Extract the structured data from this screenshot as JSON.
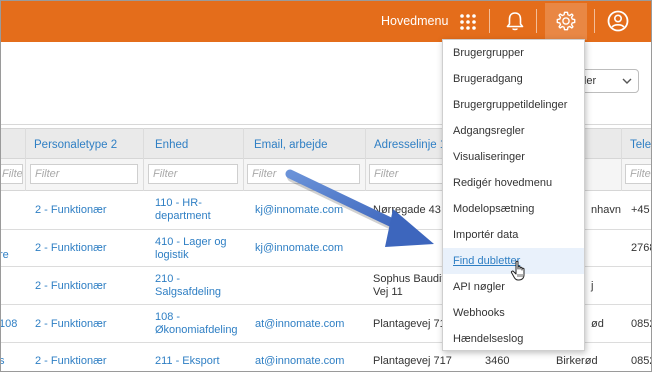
{
  "topbar": {
    "menu_label": "Hovedmenu",
    "icons": [
      "grid-icon",
      "bell-icon",
      "gear-icon",
      "user-icon"
    ],
    "color": "#e46d1b"
  },
  "toolbar": {
    "columns_button_label": "neder"
  },
  "table": {
    "headers": [
      "Personaletype 2",
      "Enhed",
      "Email, arbejde",
      "Adresselinje 1",
      "Telef"
    ],
    "filter_placeholder": "Filter",
    "rows": [
      {
        "left": "",
        "type": "2 - Funktionær",
        "unit": "110 - HR-\ndepartment",
        "email": "kj@innomate.com",
        "address": "Nørregade 43",
        "extra": "nhavn",
        "phone": "+45"
      },
      {
        "left": "re",
        "type": "2 - Funktionær",
        "unit": "410 - Lager og\nlogistik",
        "email": "kj@innomate.com",
        "address": "",
        "extra": "",
        "phone": "2768"
      },
      {
        "left": "",
        "type": "2 - Funktionær",
        "unit": "210 -\nSalgsafdeling",
        "email": "",
        "address": "Sophus Baudit\nVej 11",
        "extra": "j",
        "phone": ""
      },
      {
        "left": "108",
        "type": "2 - Funktionær",
        "unit": "108 -\nØkonomiafdeling",
        "email": "at@innomate.com",
        "address": "Plantagevej 717",
        "extra": "ød",
        "phone": "0852"
      },
      {
        "left": "s",
        "type": "2 - Funktionær",
        "unit": "211 - Eksport",
        "email": "at@innomate.com",
        "address": "Plantagevej 717",
        "zip": "3460",
        "extra": "Birkerød",
        "phone": "0852"
      }
    ]
  },
  "dropdown": {
    "items": [
      "Brugergrupper",
      "Brugeradgang",
      "Brugergruppetildelinger",
      "Adgangsregler",
      "Visualiseringer",
      "Redigér hovedmenu",
      "Modelopsætning",
      "Importér data",
      "Find dubletter",
      "API nøgler",
      "Webhooks",
      "Hændelseslog"
    ],
    "highlighted_item": "Find dubletter"
  },
  "colors": {
    "link": "#2f7fc4",
    "arrow": "#4a74c8"
  }
}
